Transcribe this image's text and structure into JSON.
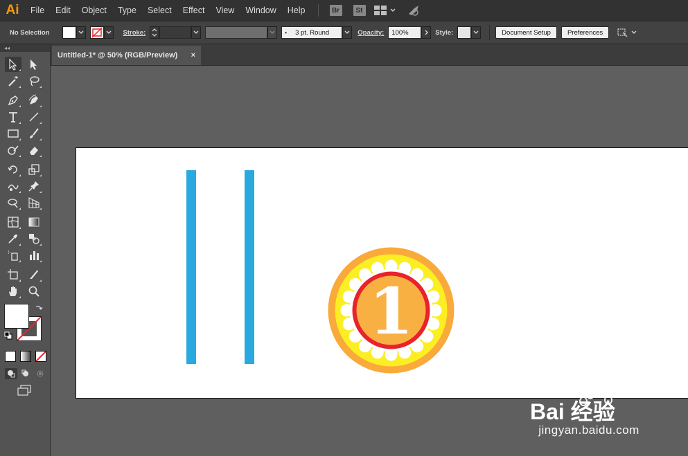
{
  "app": {
    "logo": "Ai",
    "accent": "#ff9a00"
  },
  "menu": {
    "items": [
      "File",
      "Edit",
      "Object",
      "Type",
      "Select",
      "Effect",
      "View",
      "Window",
      "Help"
    ],
    "bridge": "Br",
    "stock": "St"
  },
  "control": {
    "selection": "No Selection",
    "stroke_label": "Stroke:",
    "brush_value": "3 pt. Round",
    "opacity_label": "Opacity:",
    "opacity_value": "100%",
    "style_label": "Style:",
    "document_setup": "Document Setup",
    "preferences": "Preferences"
  },
  "tools_header": "◂◂",
  "document": {
    "tab_title": "Untitled-1* @ 50% (RGB/Preview)",
    "close": "×"
  },
  "artwork": {
    "bar_color": "#29a9df",
    "medal_number": "1",
    "medal_outer": "#f9aa3a",
    "medal_yellow": "#fbee23",
    "medal_ring": "#e9222b",
    "medal_center": "#f9b043"
  },
  "watermark": {
    "main": "Bai 经验",
    "sub": "jingyan.baidu.com"
  }
}
